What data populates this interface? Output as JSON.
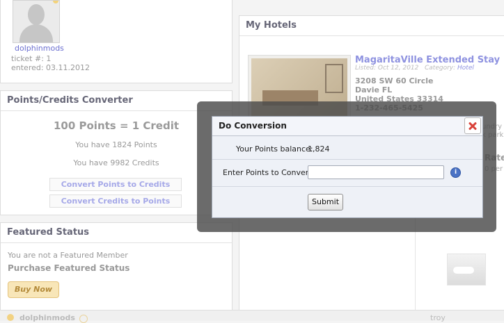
{
  "profile": {
    "username": "dolphinmods",
    "ticket": "ticket #: 1",
    "entered": "entered: 03.11.2012"
  },
  "points_panel": {
    "title": "Points/Credits Converter",
    "rate": "100 Points = 1 Credit",
    "points_have": "You have 1824 Points",
    "credits_have": "You have 9982 Credits",
    "btn_to_credits": "Convert Points to Credits",
    "btn_to_points": "Convert Credits to Points"
  },
  "featured_panel": {
    "title": "Featured Status",
    "status_text": "You are not a Featured Member",
    "purchase_link": "Purchase Featured Status",
    "buy_button": "Buy Now"
  },
  "hotels_panel": {
    "title": "My Hotels",
    "hotel": {
      "name": "MagaritaVille Extended Stay",
      "listed": "Listed: Oct 12, 2012",
      "category_label": "Category:",
      "category": "Hotel",
      "address1": "3208 SW 60 Circle",
      "address2": "Davie FL",
      "address3": "United States 33314",
      "phone": "1-232-465-5425"
    },
    "side_text1": "undry",
    "side_text2": "k park",
    "side_text3": "Rate",
    "side_text4": "0 per"
  },
  "footer": {
    "username": "dolphinmods",
    "right_text": "troy"
  },
  "dialog": {
    "title": "Do Conversion",
    "balance_label": "Your Points balance:",
    "balance_value": "1,824",
    "enter_label": "Enter Points to Convert:",
    "input_value": "",
    "input_placeholder": "",
    "info_icon_glyph": "i",
    "submit_label": "Submit"
  },
  "colors": {
    "accent_link": "#6b6fd0",
    "close_red": "#d9423a",
    "info_blue": "#4b73c5"
  }
}
